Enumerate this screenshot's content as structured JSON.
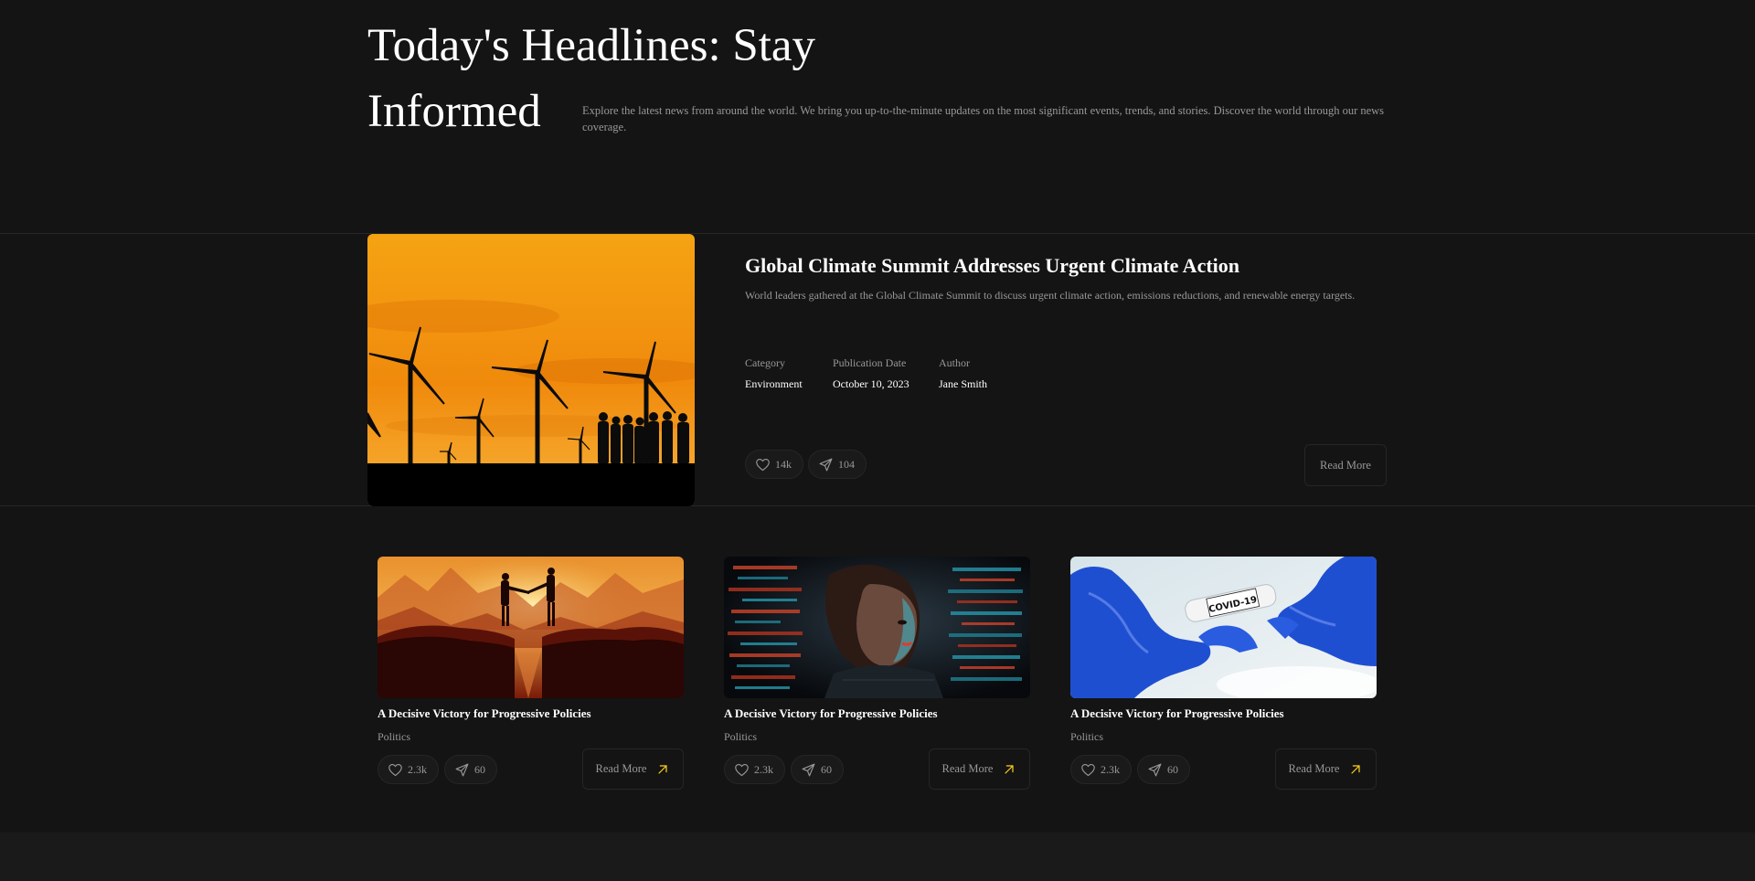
{
  "hero": {
    "title": "Today's Headlines: Stay Informed",
    "description": "Explore the latest news from around the world. We bring you up-to-the-minute updates on the most significant events, trends, and stories. Discover the world through our news coverage."
  },
  "featured": {
    "title": "Global Climate Summit Addresses Urgent Climate Action",
    "description": "World leaders gathered at the Global Climate Summit to discuss urgent climate action, emissions reductions, and renewable energy targets.",
    "meta": [
      {
        "label": "Category",
        "value": "Environment"
      },
      {
        "label": "Publication Date",
        "value": "October 10, 2023"
      },
      {
        "label": "Author",
        "value": "Jane Smith"
      }
    ],
    "likes": "14k",
    "shares": "104",
    "read_more": "Read More",
    "image": "wind-turbines-sunset"
  },
  "cards": [
    {
      "title": "A Decisive Victory for Progressive Policies",
      "category": "Politics",
      "likes": "2.3k",
      "shares": "60",
      "read_more": "Read More",
      "image": "handshake-on-cliffs"
    },
    {
      "title": "A Decisive Victory for Progressive Policies",
      "category": "Politics",
      "likes": "2.3k",
      "shares": "60",
      "read_more": "Read More",
      "image": "woman-digital-code"
    },
    {
      "title": "A Decisive Victory for Progressive Policies",
      "category": "Politics",
      "likes": "2.3k",
      "shares": "60",
      "read_more": "Read More",
      "image": "covid-test-tube"
    }
  ],
  "colors": {
    "background": "#141414",
    "border": "#262626",
    "muted_text": "#98989a",
    "accent": "#ffd11a"
  }
}
